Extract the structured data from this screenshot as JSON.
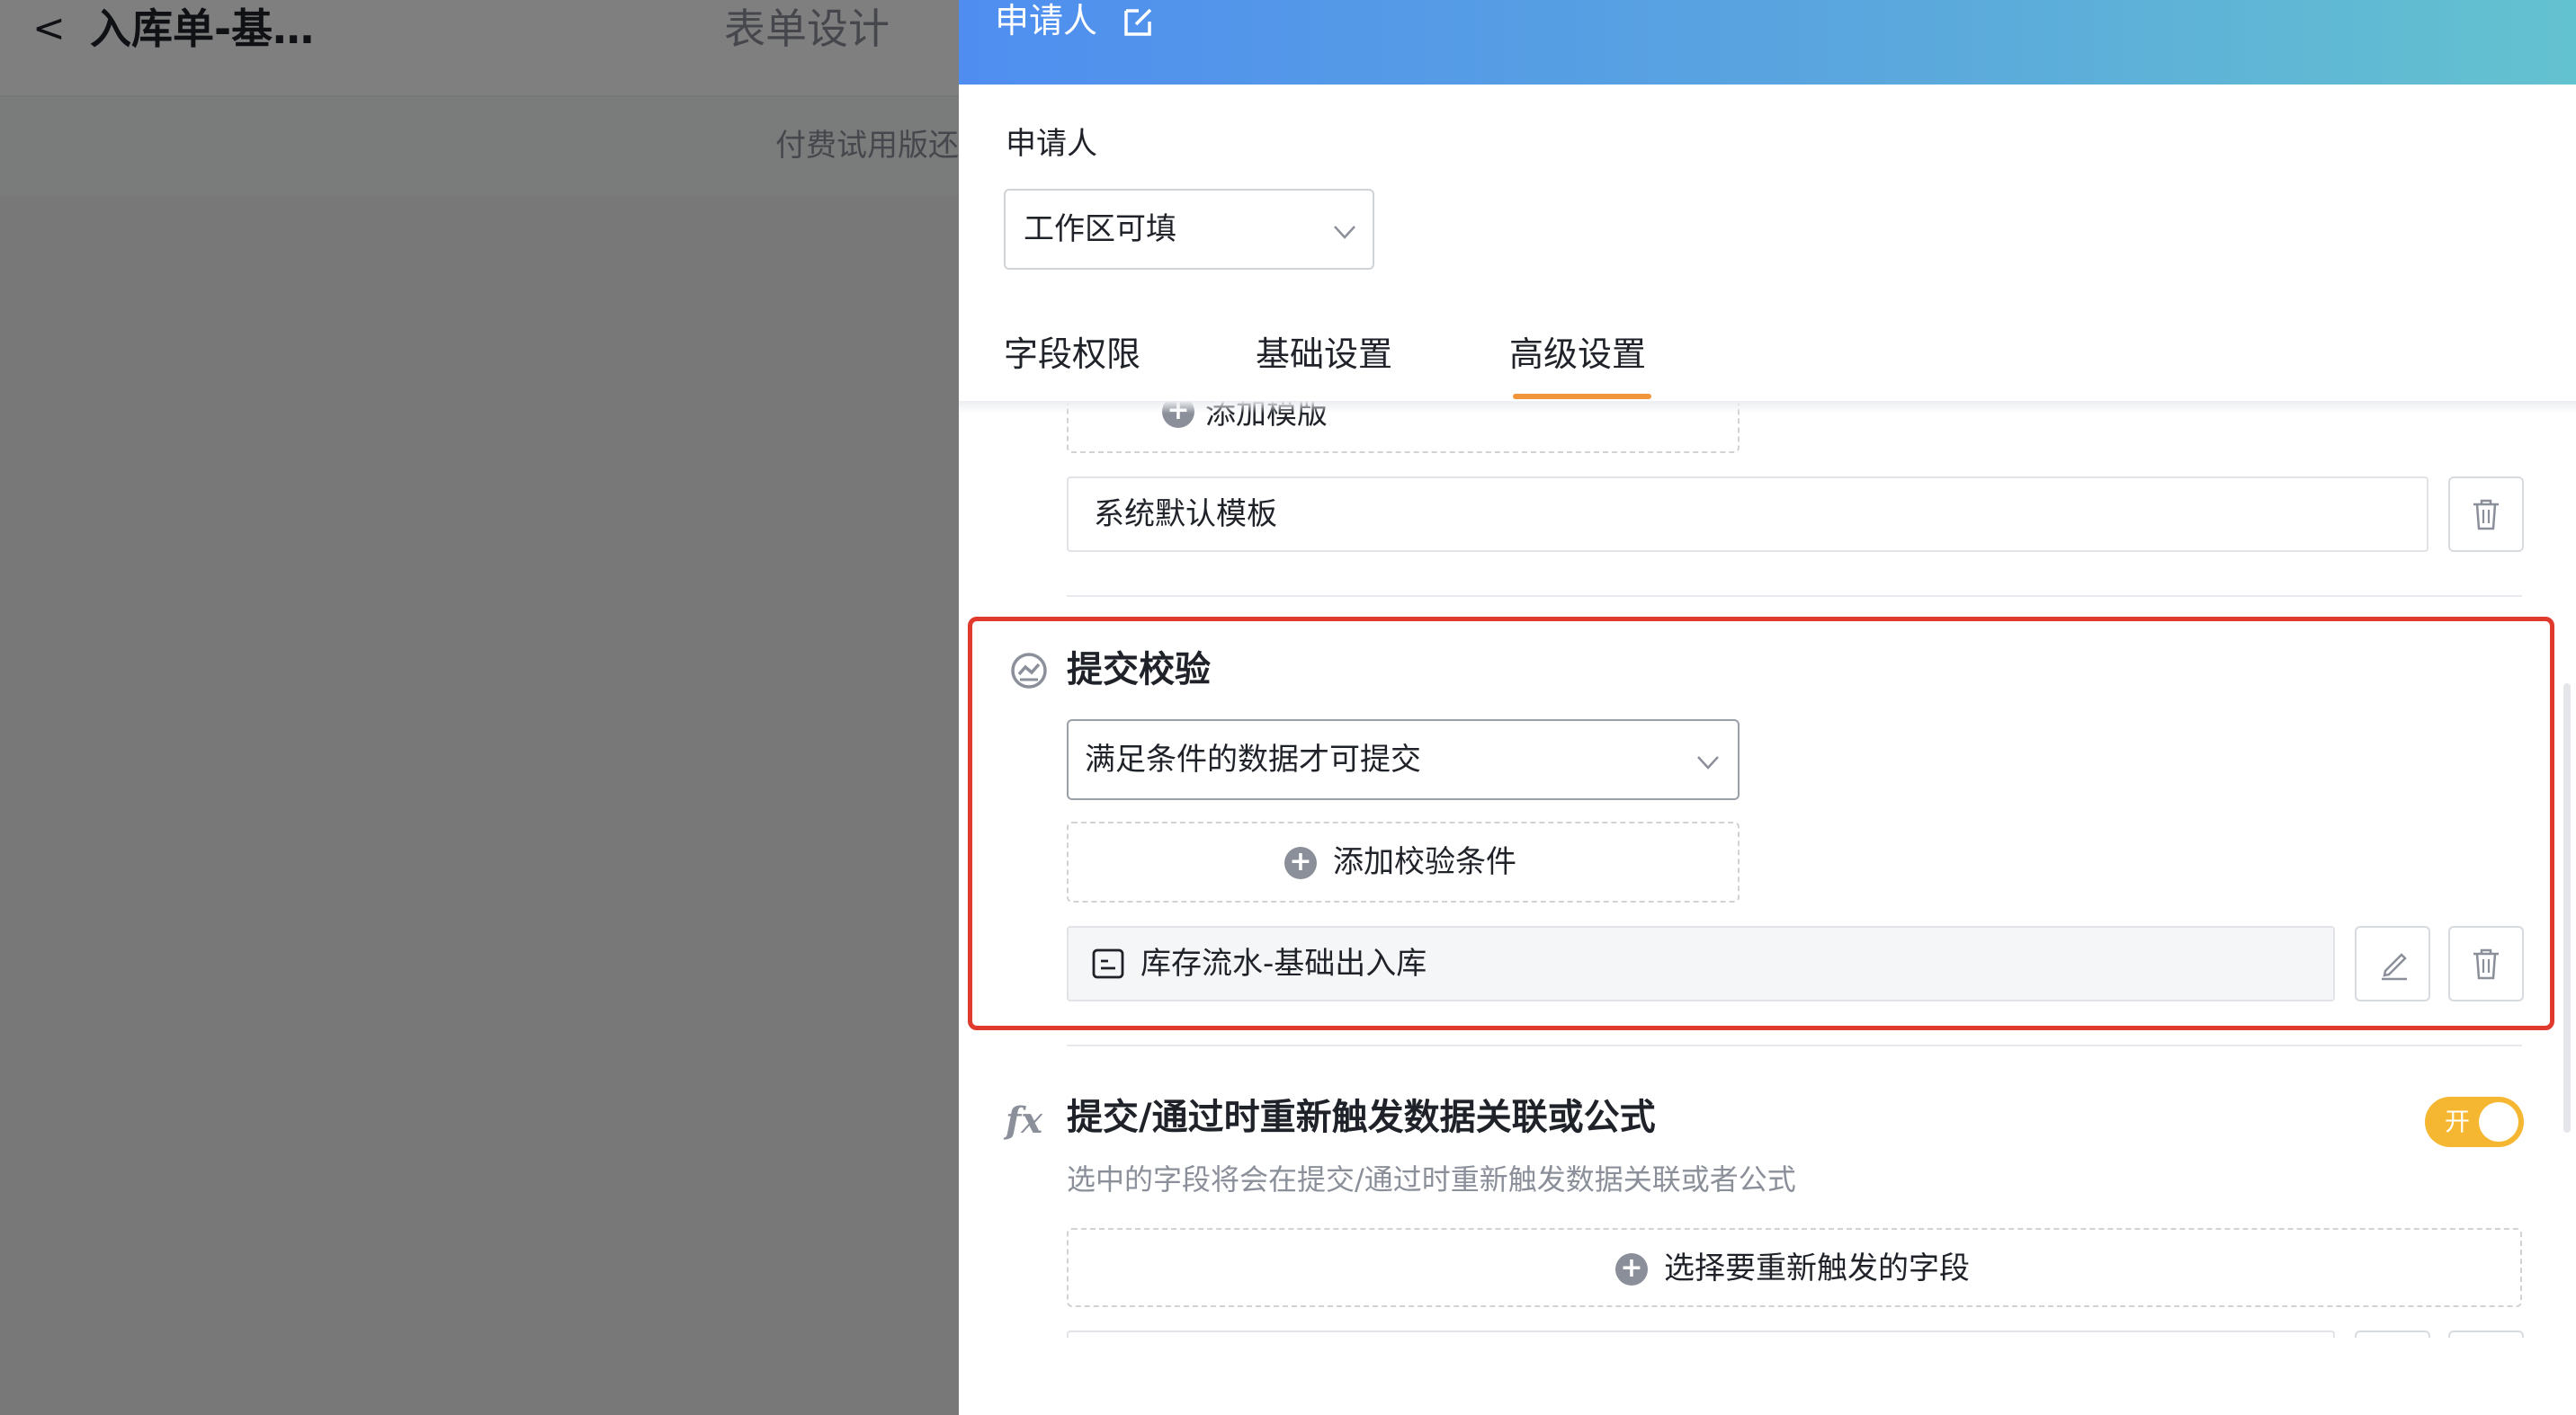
{
  "background": {
    "back_glyph": "<",
    "title": "入库单-基…",
    "tab": "表单设计",
    "notice": "付费试用版还"
  },
  "drawer": {
    "title": "申请人",
    "title_edit_icon": "edit-icon",
    "applicant_label": "申请人",
    "permission_select": {
      "value": "工作区可填"
    },
    "tabs": [
      {
        "label": "字段权限",
        "active": false
      },
      {
        "label": "基础设置",
        "active": false
      },
      {
        "label": "高级设置",
        "active": true
      }
    ],
    "add_template_label": "添加模版",
    "template_row_label": "系统默认模板",
    "submit_check": {
      "title": "提交校验",
      "mode_select": {
        "value": "满足条件的数据才可提交"
      },
      "add_condition_label": "添加校验条件",
      "condition_label": "库存流水-基础出入库"
    },
    "retrigger": {
      "icon_glyph": "fx",
      "title": "提交/通过时重新触发数据关联或公式",
      "toggle_label": "开",
      "toggle_on": true,
      "description": "选中的字段将会在提交/通过时重新触发数据关联或者公式",
      "select_field_label": "选择要重新触发的字段"
    }
  },
  "colors": {
    "accent_tab": "#f0953c",
    "highlight": "#e0392d",
    "toggle_on": "#f5b731",
    "header_gradient_start": "#4f8ef0",
    "header_gradient_end": "#63c2cf"
  }
}
